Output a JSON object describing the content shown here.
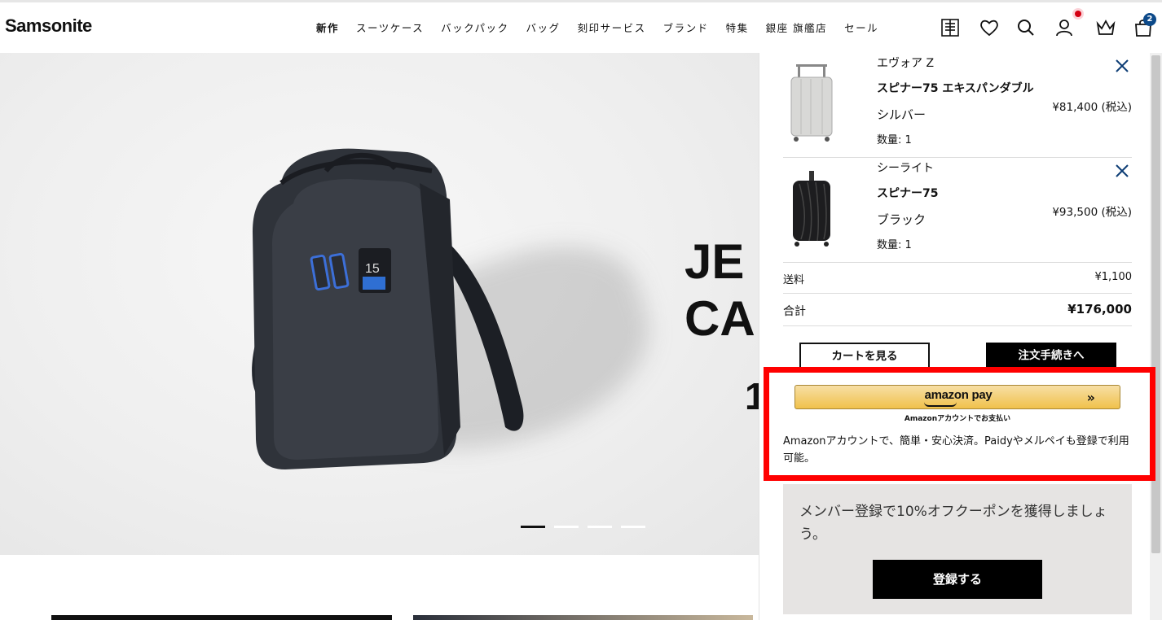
{
  "header": {
    "logo": "Samsonite",
    "nav": [
      "新作",
      "スーツケース",
      "バックパック",
      "バッグ",
      "刻印サービス",
      "ブランド",
      "特集",
      "銀座 旗艦店",
      "セール"
    ],
    "cart_count": "2"
  },
  "hero": {
    "title": "JE\nCA",
    "number": "1",
    "slides": 4,
    "active_slide": 1
  },
  "cart": {
    "items": [
      {
        "brand": "エヴォア Z",
        "name": "スピナー75 エキスパンダブル",
        "color": "シルバー",
        "qty": "数量: 1",
        "price": "¥81,400 (税込)"
      },
      {
        "brand": "シーライト",
        "name": "スピナー75",
        "color": "ブラック",
        "qty": "数量: 1",
        "price": "¥93,500 (税込)"
      }
    ],
    "shipping_label": "送料",
    "shipping_value": "¥1,100",
    "total_label": "合計",
    "total_value": "¥176,000",
    "view_cart": "カートを見る",
    "checkout": "注文手続きへ"
  },
  "amazon": {
    "logo": "amazon pay",
    "arrows": "»",
    "sub": "Amazonアカウントでお支払い",
    "desc": "Amazonアカウントで、簡単・安心決済。Paidyやメルペイも登録で利用可能。"
  },
  "promo": {
    "text": "メンバー登録で10%オフクーポンを獲得しましょう。",
    "button": "登録する"
  },
  "colors": {
    "highlight": "#ff0000",
    "badge": "#0d4a8a",
    "notify": "#d40012"
  }
}
